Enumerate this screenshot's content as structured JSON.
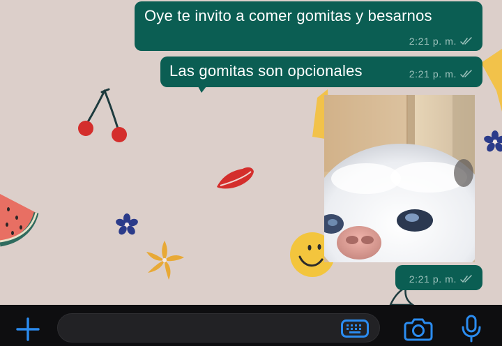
{
  "chat": {
    "messages": [
      {
        "text": "Oye te invito a comer gomitas y besarnos",
        "time": "2:21 p. m."
      },
      {
        "text": "Las gomitas son opcionales",
        "time": "2:21 p. m."
      },
      {
        "image_subject": "white-cat-face",
        "time": "2:21 p. m."
      }
    ],
    "bubble_color": "#0b5e53",
    "wallpaper_color": "#dccfca",
    "wallpaper_icons": [
      "cherries-icon",
      "lips-icon",
      "watermelon-icon",
      "blue-flower-icon",
      "yellow-flower-icon",
      "smiley-icon",
      "star-icon"
    ]
  },
  "composer": {
    "input_value": "",
    "input_placeholder": "",
    "icons": [
      "plus-icon",
      "keyboard-icon",
      "camera-icon",
      "microphone-icon"
    ],
    "accent_color": "#2b8cf0"
  }
}
